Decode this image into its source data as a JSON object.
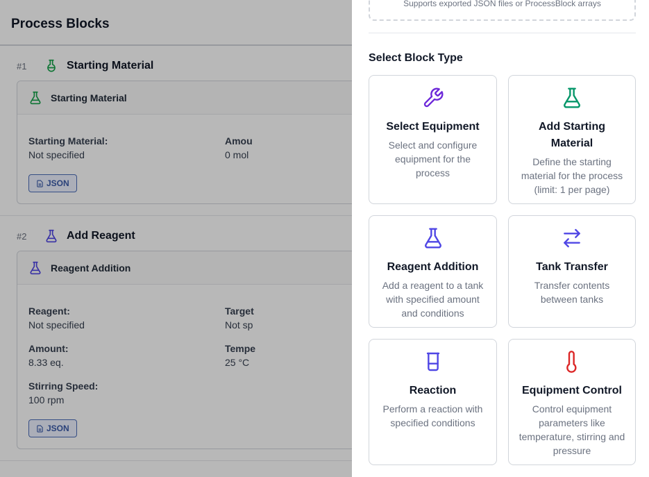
{
  "page": {
    "title": "Process Blocks"
  },
  "blocks": [
    {
      "number": "#1",
      "name": "Starting Material",
      "icon": "flask-round-icon",
      "color": "#16a34a",
      "card_title": "Starting Material",
      "fields": [
        {
          "label": "Starting Material:",
          "value": "Not specified"
        },
        {
          "label": "Amou",
          "value": "0 mol"
        }
      ],
      "json_label": "JSON"
    },
    {
      "number": "#2",
      "name": "Add Reagent",
      "icon": "flask-conical-icon",
      "color": "#4f46e5",
      "card_title": "Reagent Addition",
      "fields": [
        {
          "label": "Reagent:",
          "value": "Not specified"
        },
        {
          "label": "Target",
          "value": "Not sp"
        },
        {
          "label": "Amount:",
          "value": "8.33 eq."
        },
        {
          "label": "Tempe",
          "value": "25 °C"
        },
        {
          "label": "Stirring Speed:",
          "value": "100 rpm"
        }
      ],
      "json_label": "JSON"
    }
  ],
  "drawer": {
    "drop_hint": "Supports exported JSON files or ProcessBlock arrays",
    "section_title": "Select Block Type",
    "tiles": [
      {
        "title": "Select Equipment",
        "desc": "Select and configure equipment for the process",
        "icon": "wrench-icon",
        "color": "#6d28d9"
      },
      {
        "title": "Add Starting Material",
        "desc": "Define the starting material for the process (limit: 1 per page)",
        "icon": "flask-conical-icon",
        "color": "#059669"
      },
      {
        "title": "Reagent Addition",
        "desc": "Add a reagent to a tank with specified amount and conditions",
        "icon": "flask-conical-icon",
        "color": "#4f46e5"
      },
      {
        "title": "Tank Transfer",
        "desc": "Transfer contents between tanks",
        "icon": "arrows-left-right-icon",
        "color": "#4f46e5"
      },
      {
        "title": "Reaction",
        "desc": "Perform a reaction with specified conditions",
        "icon": "beaker-icon",
        "color": "#4f46e5"
      },
      {
        "title": "Equipment Control",
        "desc": "Control equipment parameters like temperature, stirring and pressure",
        "icon": "thermometer-icon",
        "color": "#dc2626"
      }
    ]
  }
}
